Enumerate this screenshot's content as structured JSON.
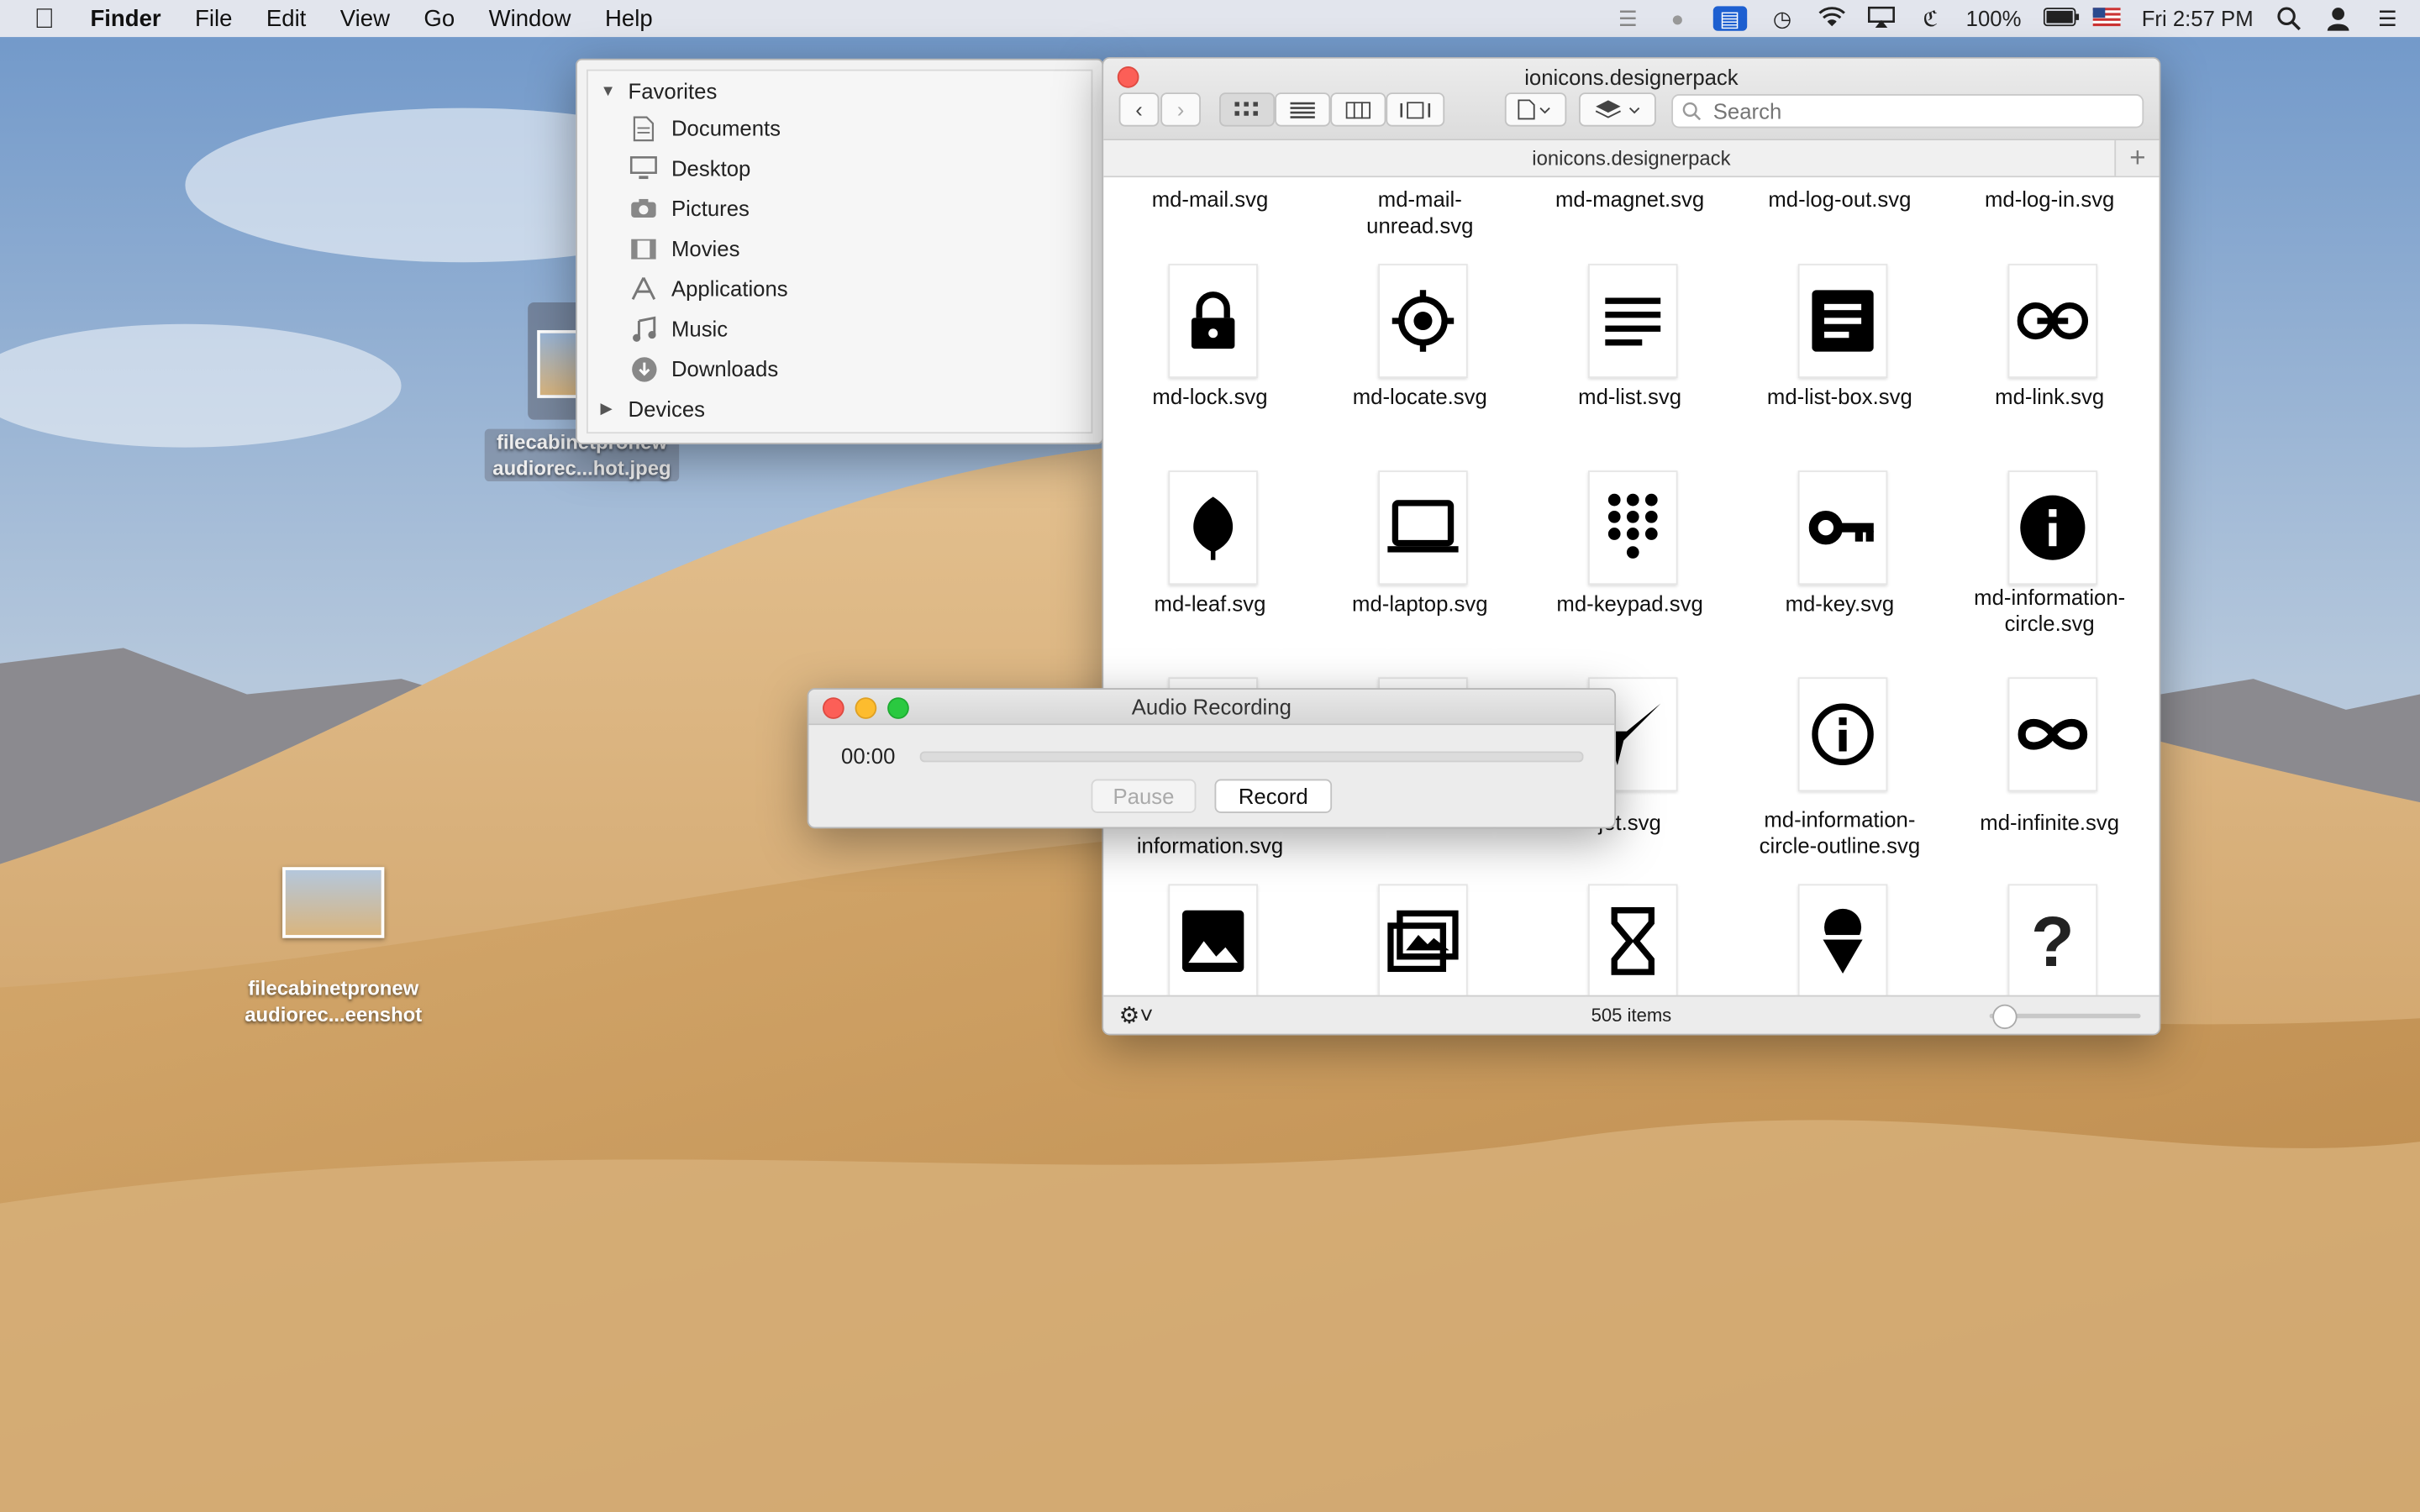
{
  "menubar": {
    "app_name": "Finder",
    "menus": [
      "File",
      "Edit",
      "View",
      "Go",
      "Window",
      "Help"
    ],
    "battery": "100%",
    "clock": "Fri 2:57 PM"
  },
  "sidebar": {
    "favorites_label": "Favorites",
    "items": [
      {
        "label": "Documents",
        "icon": "document-icon"
      },
      {
        "label": "Desktop",
        "icon": "desktop-icon"
      },
      {
        "label": "Pictures",
        "icon": "camera-icon"
      },
      {
        "label": "Movies",
        "icon": "film-icon"
      },
      {
        "label": "Applications",
        "icon": "applications-icon"
      },
      {
        "label": "Music",
        "icon": "music-note-icon"
      },
      {
        "label": "Downloads",
        "icon": "download-icon"
      }
    ],
    "devices_label": "Devices"
  },
  "finder": {
    "title": "ionicons.designerpack",
    "path": "ionicons.designerpack",
    "search_placeholder": "Search",
    "item_count": "505 items",
    "top_row_labels": [
      "md-mail.svg",
      "md-mail-\nunread.svg",
      "md-magnet.svg",
      "md-log-out.svg",
      "md-log-in.svg"
    ],
    "row2": [
      "md-lock.svg",
      "md-locate.svg",
      "md-list.svg",
      "md-list-box.svg",
      "md-link.svg"
    ],
    "row3": [
      "md-leaf.svg",
      "md-laptop.svg",
      "md-keypad.svg",
      "md-key.svg",
      "md-information-\ncircle.svg"
    ],
    "row4": [
      "information.svg",
      "",
      "jet.svg",
      "md-information-\ncircle-outline.svg",
      "md-infinite.svg"
    ]
  },
  "audio": {
    "title": "Audio Recording",
    "time": "00:00",
    "progress": 0,
    "pause_label": "Pause",
    "record_label": "Record"
  },
  "desktop_icons": [
    {
      "line1": "filecabinetpronew",
      "line2": "audiorec...hot.jpeg"
    },
    {
      "line1": "filecabinetpronew",
      "line2": "audiorec...eenshot"
    }
  ]
}
